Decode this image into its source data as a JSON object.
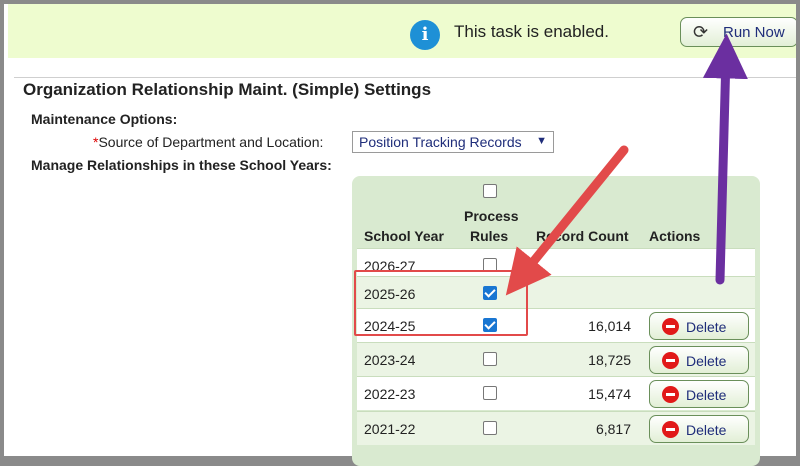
{
  "banner": {
    "message": "This task is enabled.",
    "run_button": "Run Now"
  },
  "section": {
    "title": "Organization Relationship Maint. (Simple) Settings",
    "maintenance_options_label": "Maintenance Options:",
    "required_marker": "*",
    "source_label": "Source of Department and Location:",
    "source_value": "Position Tracking Records",
    "manage_label": "Manage Relationships in these School Years:"
  },
  "table": {
    "headers": {
      "school_year": "School Year",
      "process_rules_1": "Process",
      "process_rules_2": "Rules",
      "record_count": "Record Count",
      "actions": "Actions"
    },
    "delete_label": "Delete",
    "rows": [
      {
        "year": "2026-27",
        "checked": false,
        "count": "",
        "has_delete": false
      },
      {
        "year": "2025-26",
        "checked": true,
        "count": "",
        "has_delete": false
      },
      {
        "year": "2024-25",
        "checked": true,
        "count": "16,014",
        "has_delete": true
      },
      {
        "year": "2023-24",
        "checked": false,
        "count": "18,725",
        "has_delete": true
      },
      {
        "year": "2022-23",
        "checked": false,
        "count": "15,474",
        "has_delete": true
      },
      {
        "year": "2021-22",
        "checked": false,
        "count": "6,817",
        "has_delete": true
      }
    ]
  },
  "colors": {
    "banner_bg": "#eefccf",
    "annotation_red": "#e24a4a",
    "annotation_purple": "#6b2fa0",
    "link_blue": "#1f2d7a"
  }
}
